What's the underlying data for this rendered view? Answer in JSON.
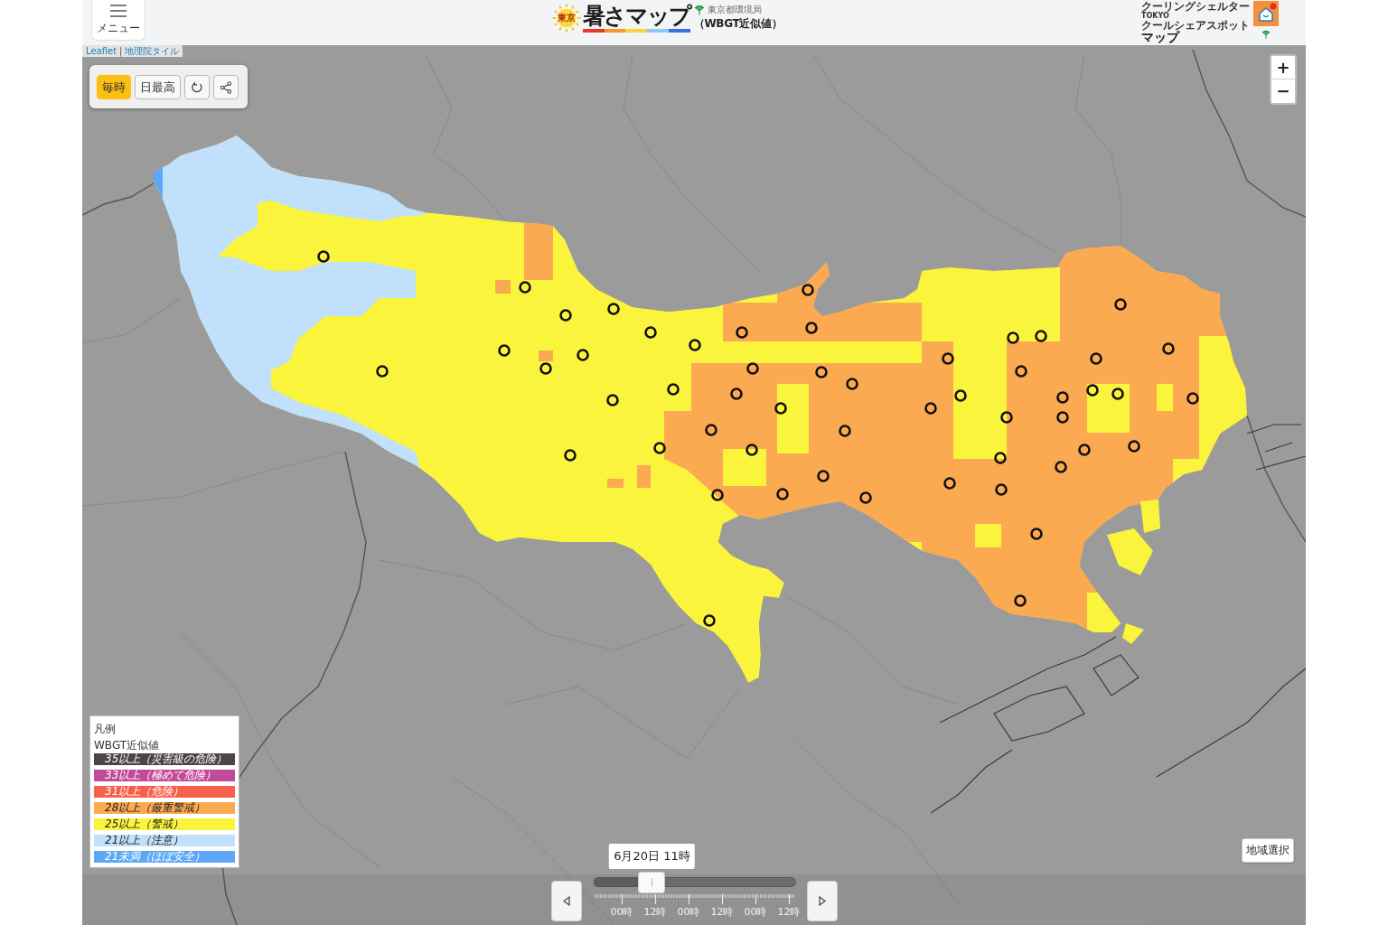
{
  "header": {
    "menu_button": {
      "label": "メニュー"
    },
    "logo": {
      "badge": "東京",
      "title": "暑さマップ",
      "agency": "東京都環境局",
      "subtitle": "（WBGT近似値）"
    },
    "partner_logo": {
      "lines": [
        {
          "kind": "tagline",
          "text": "クーリングシェルター"
        },
        {
          "kind": "wordmark",
          "text": "TOKYO"
        },
        {
          "kind": "tagline",
          "text": "クールシェアスポット"
        },
        {
          "kind": "title",
          "text": "マップ"
        }
      ]
    }
  },
  "map": {
    "attribution": {
      "links": [
        "Leaflet",
        "地理院タイル"
      ],
      "separator": "|"
    },
    "mode_buttons": [
      {
        "label": "毎時",
        "selected": true
      },
      {
        "label": "日最高",
        "selected": false
      }
    ],
    "zoom": {
      "zoom_in": "+",
      "zoom_out": "−"
    },
    "region_button": "地域選択"
  },
  "legend": {
    "title": "凡例",
    "subtitle": "WBGT近似値",
    "items": [
      {
        "label": "35以上（災害級の危険）",
        "color": "#4b4549"
      },
      {
        "label": "33以上（極めて危険）",
        "color": "#c24a9a"
      },
      {
        "label": "31以上（危険）",
        "color": "#f7604a"
      },
      {
        "label": "28以上（厳重警戒）",
        "color": "#fbaa52"
      },
      {
        "label": "25以上（警戒）",
        "color": "#fbf43c"
      },
      {
        "label": "21以上（注意）",
        "color": "#c0e0fb"
      },
      {
        "label": "21未満（ほぼ安全）",
        "color": "#5ca8f6"
      }
    ]
  },
  "time_slider": {
    "tooltip": "6月20日 11時",
    "level": 0.29,
    "tick_labels": [
      "00時",
      "12時",
      "00時",
      "12時",
      "00時",
      "12時"
    ]
  }
}
